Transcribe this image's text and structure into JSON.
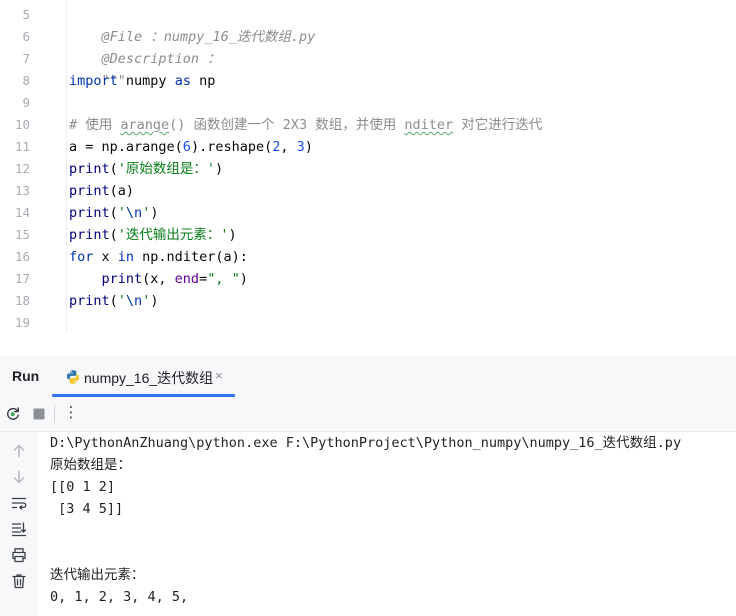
{
  "editor": {
    "line_numbers": [
      "5",
      "6",
      "7",
      "8",
      "9",
      "10",
      "11",
      "12",
      "13",
      "14",
      "15",
      "16",
      "17",
      "18",
      "19"
    ],
    "lines": {
      "l5": "@File ：numpy_16_迭代数组.py",
      "l6": "@Description ：",
      "l7": "\"\"\"",
      "l8_kw1": "import",
      "l8_mid": " numpy ",
      "l8_kw2": "as",
      "l8_end": " np",
      "l10_a": "# 使用 ",
      "l10_b": "arange",
      "l10_c": "() 函数创建一个 2X3 数组，并使用 ",
      "l10_d": "nditer",
      "l10_e": " 对它进行迭代",
      "l11_a": "a = np.arange(",
      "l11_b": "6",
      "l11_c": ").reshape(",
      "l11_d": "2",
      "l11_e": ", ",
      "l11_f": "3",
      "l11_g": ")",
      "l12_fn": "print",
      "l12_a": "(",
      "l12_str": "'原始数组是：'",
      "l12_b": ")",
      "l13_fn": "print",
      "l13_rest": "(a)",
      "l14_fn": "print",
      "l14_a": "(",
      "l14_q1": "'",
      "l14_esc": "\\n",
      "l14_q2": "'",
      "l14_b": ")",
      "l15_fn": "print",
      "l15_a": "(",
      "l15_str": "'迭代输出元素：'",
      "l15_b": ")",
      "l16_kw1": "for",
      "l16_a": " x ",
      "l16_kw2": "in",
      "l16_b": " np.nditer(a):",
      "l17_indent": "    ",
      "l17_fn": "print",
      "l17_a": "(x, ",
      "l17_param": "end",
      "l17_b": "=",
      "l17_str": "\", \"",
      "l17_c": ")",
      "l18_fn": "print",
      "l18_a": "(",
      "l18_q1": "'",
      "l18_esc": "\\n",
      "l18_q2": "'",
      "l18_b": ")"
    }
  },
  "run_window": {
    "title": "Run",
    "tab_label": "numpy_16_迭代数组",
    "tab_close": "×",
    "toolbar_more": "⋮",
    "output": [
      "D:\\PythonAnZhuang\\python.exe F:\\PythonProject\\Python_numpy\\numpy_16_迭代数组.py",
      "原始数组是：",
      "[[0 1 2]",
      " [3 4 5]]",
      "",
      "",
      "迭代输出元素：",
      "0, 1, 2, 3, 4, 5,"
    ]
  },
  "icons": {
    "tab": "python-file-icon",
    "toolbar": [
      "rerun-icon",
      "stop-icon",
      "more-options-icon"
    ],
    "side": [
      "arrow-up-icon",
      "arrow-down-icon",
      "soft-wrap-icon",
      "scroll-to-end-icon",
      "print-icon",
      "trash-icon"
    ]
  },
  "colors": {
    "accent": "#3574f0",
    "keyword": "#0033b3",
    "string": "#067d17",
    "number": "#1750eb",
    "comment": "#8c8c8c"
  }
}
